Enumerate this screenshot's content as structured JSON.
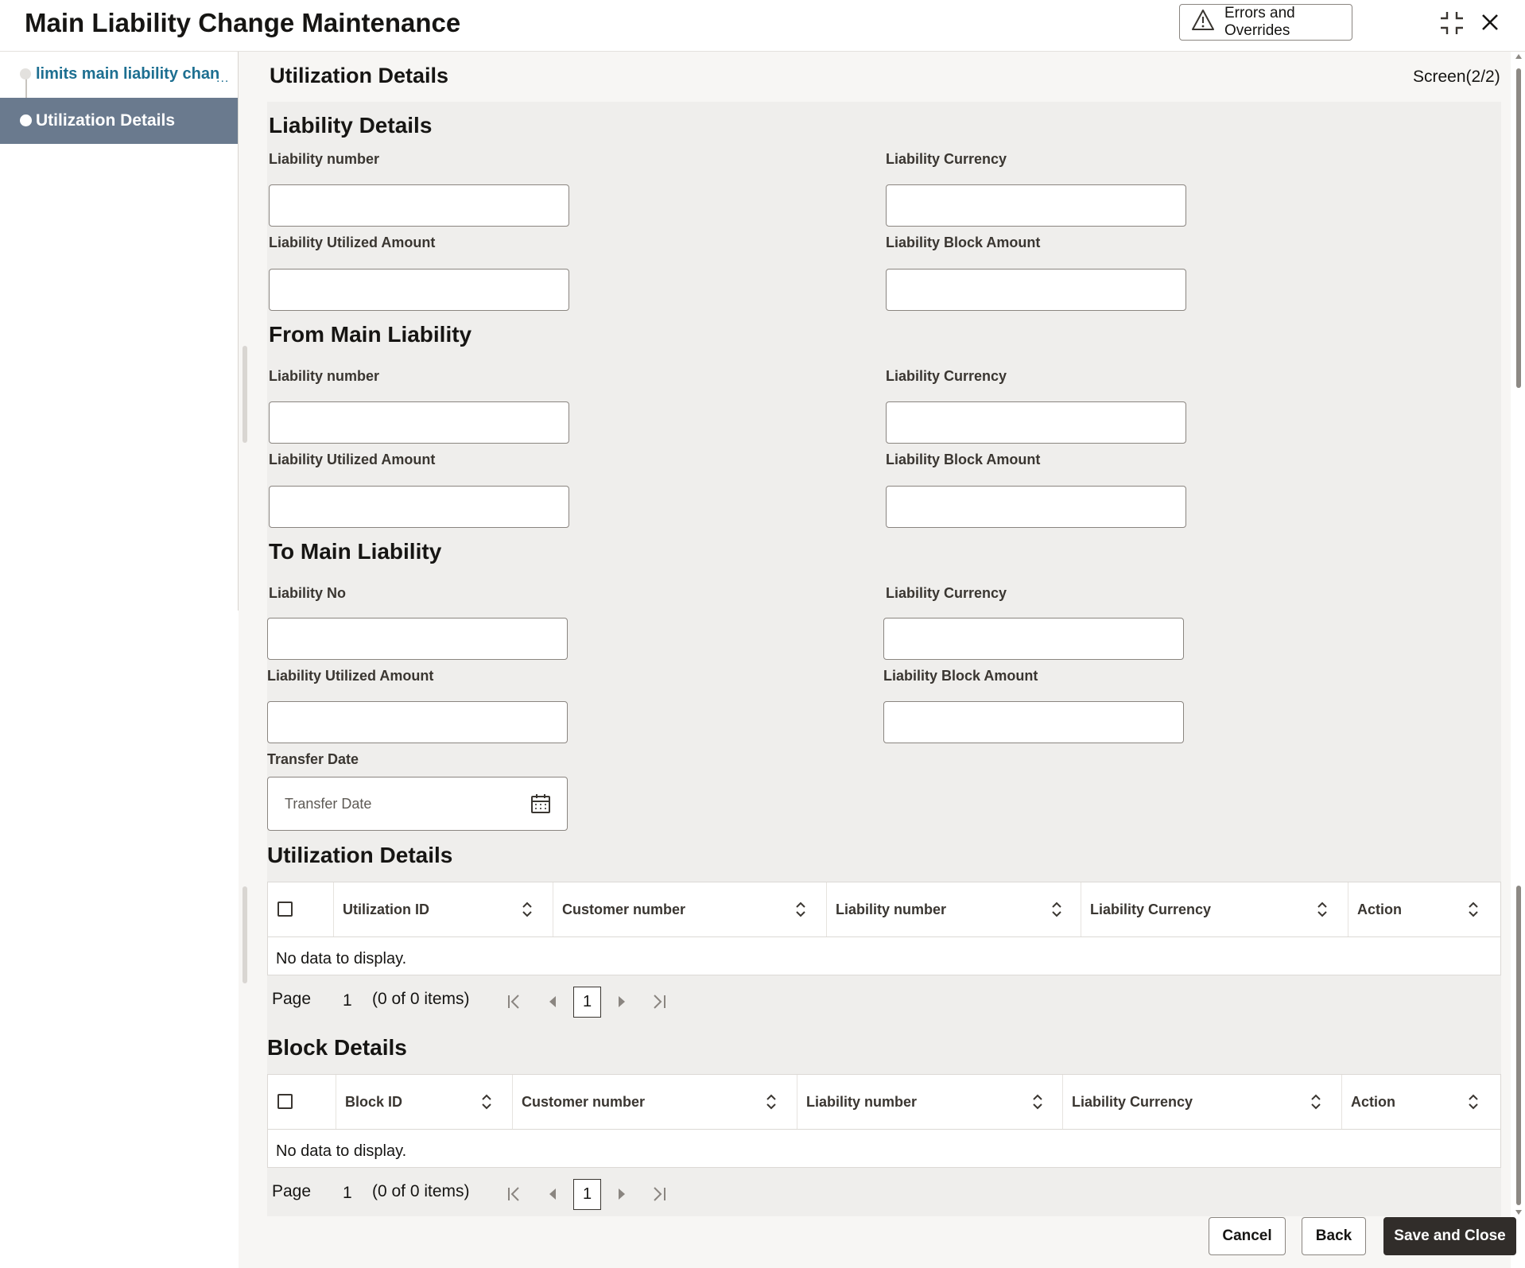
{
  "header": {
    "title": "Main Liability Change Maintenance",
    "errors_button": "Errors and Overrides"
  },
  "nav": {
    "items": [
      {
        "label": "limits main liability chan",
        "ellipsis": "...",
        "active": false
      },
      {
        "label": "Utilization Details",
        "active": true
      }
    ]
  },
  "screen": {
    "title": "Utilization Details",
    "counter": "Screen(2/2)"
  },
  "liability_details": {
    "title": "Liability Details",
    "fields": {
      "number": {
        "label": "Liability number",
        "value": ""
      },
      "currency": {
        "label": "Liability Currency",
        "value": ""
      },
      "utilized": {
        "label": "Liability Utilized Amount",
        "value": ""
      },
      "block": {
        "label": "Liability Block Amount",
        "value": ""
      }
    }
  },
  "from_main": {
    "title": "From Main Liability",
    "fields": {
      "number": {
        "label": "Liability number",
        "value": ""
      },
      "currency": {
        "label": "Liability Currency",
        "value": ""
      },
      "utilized": {
        "label": "Liability Utilized Amount",
        "value": ""
      },
      "block": {
        "label": "Liability Block Amount",
        "value": ""
      }
    }
  },
  "to_main": {
    "title": "To Main Liability",
    "fields": {
      "number": {
        "label": "Liability No",
        "value": ""
      },
      "currency": {
        "label": "Liability Currency",
        "value": ""
      },
      "utilized": {
        "label": "Liability Utilized Amount",
        "value": ""
      },
      "block": {
        "label": "Liability Block Amount",
        "value": ""
      },
      "transfer_date": {
        "label": "Transfer Date",
        "placeholder": "Transfer Date",
        "value": ""
      }
    }
  },
  "utilization_table": {
    "title": "Utilization Details",
    "columns": [
      "Utilization ID",
      "Customer number",
      "Liability number",
      "Liability Currency",
      "Action"
    ],
    "empty": "No data to display.",
    "pager": {
      "page_label": "Page",
      "page": "1",
      "summary": "(0 of 0 items)",
      "current": "1"
    }
  },
  "block_table": {
    "title": "Block Details",
    "columns": [
      "Block ID",
      "Customer number",
      "Liability number",
      "Liability Currency",
      "Action"
    ],
    "empty": "No data to display.",
    "pager": {
      "page_label": "Page",
      "page": "1",
      "summary": "(0 of 0 items)",
      "current": "1"
    }
  },
  "footer": {
    "cancel": "Cancel",
    "back": "Back",
    "save_close": "Save and Close"
  },
  "icons": {
    "warning": "warning-triangle-icon",
    "minimize": "compress-icon",
    "close": "close-icon",
    "calendar": "calendar-icon",
    "sort": "sort-icon",
    "first": "first-page-icon",
    "prev": "previous-page-icon",
    "next": "next-page-icon",
    "last": "last-page-icon"
  }
}
